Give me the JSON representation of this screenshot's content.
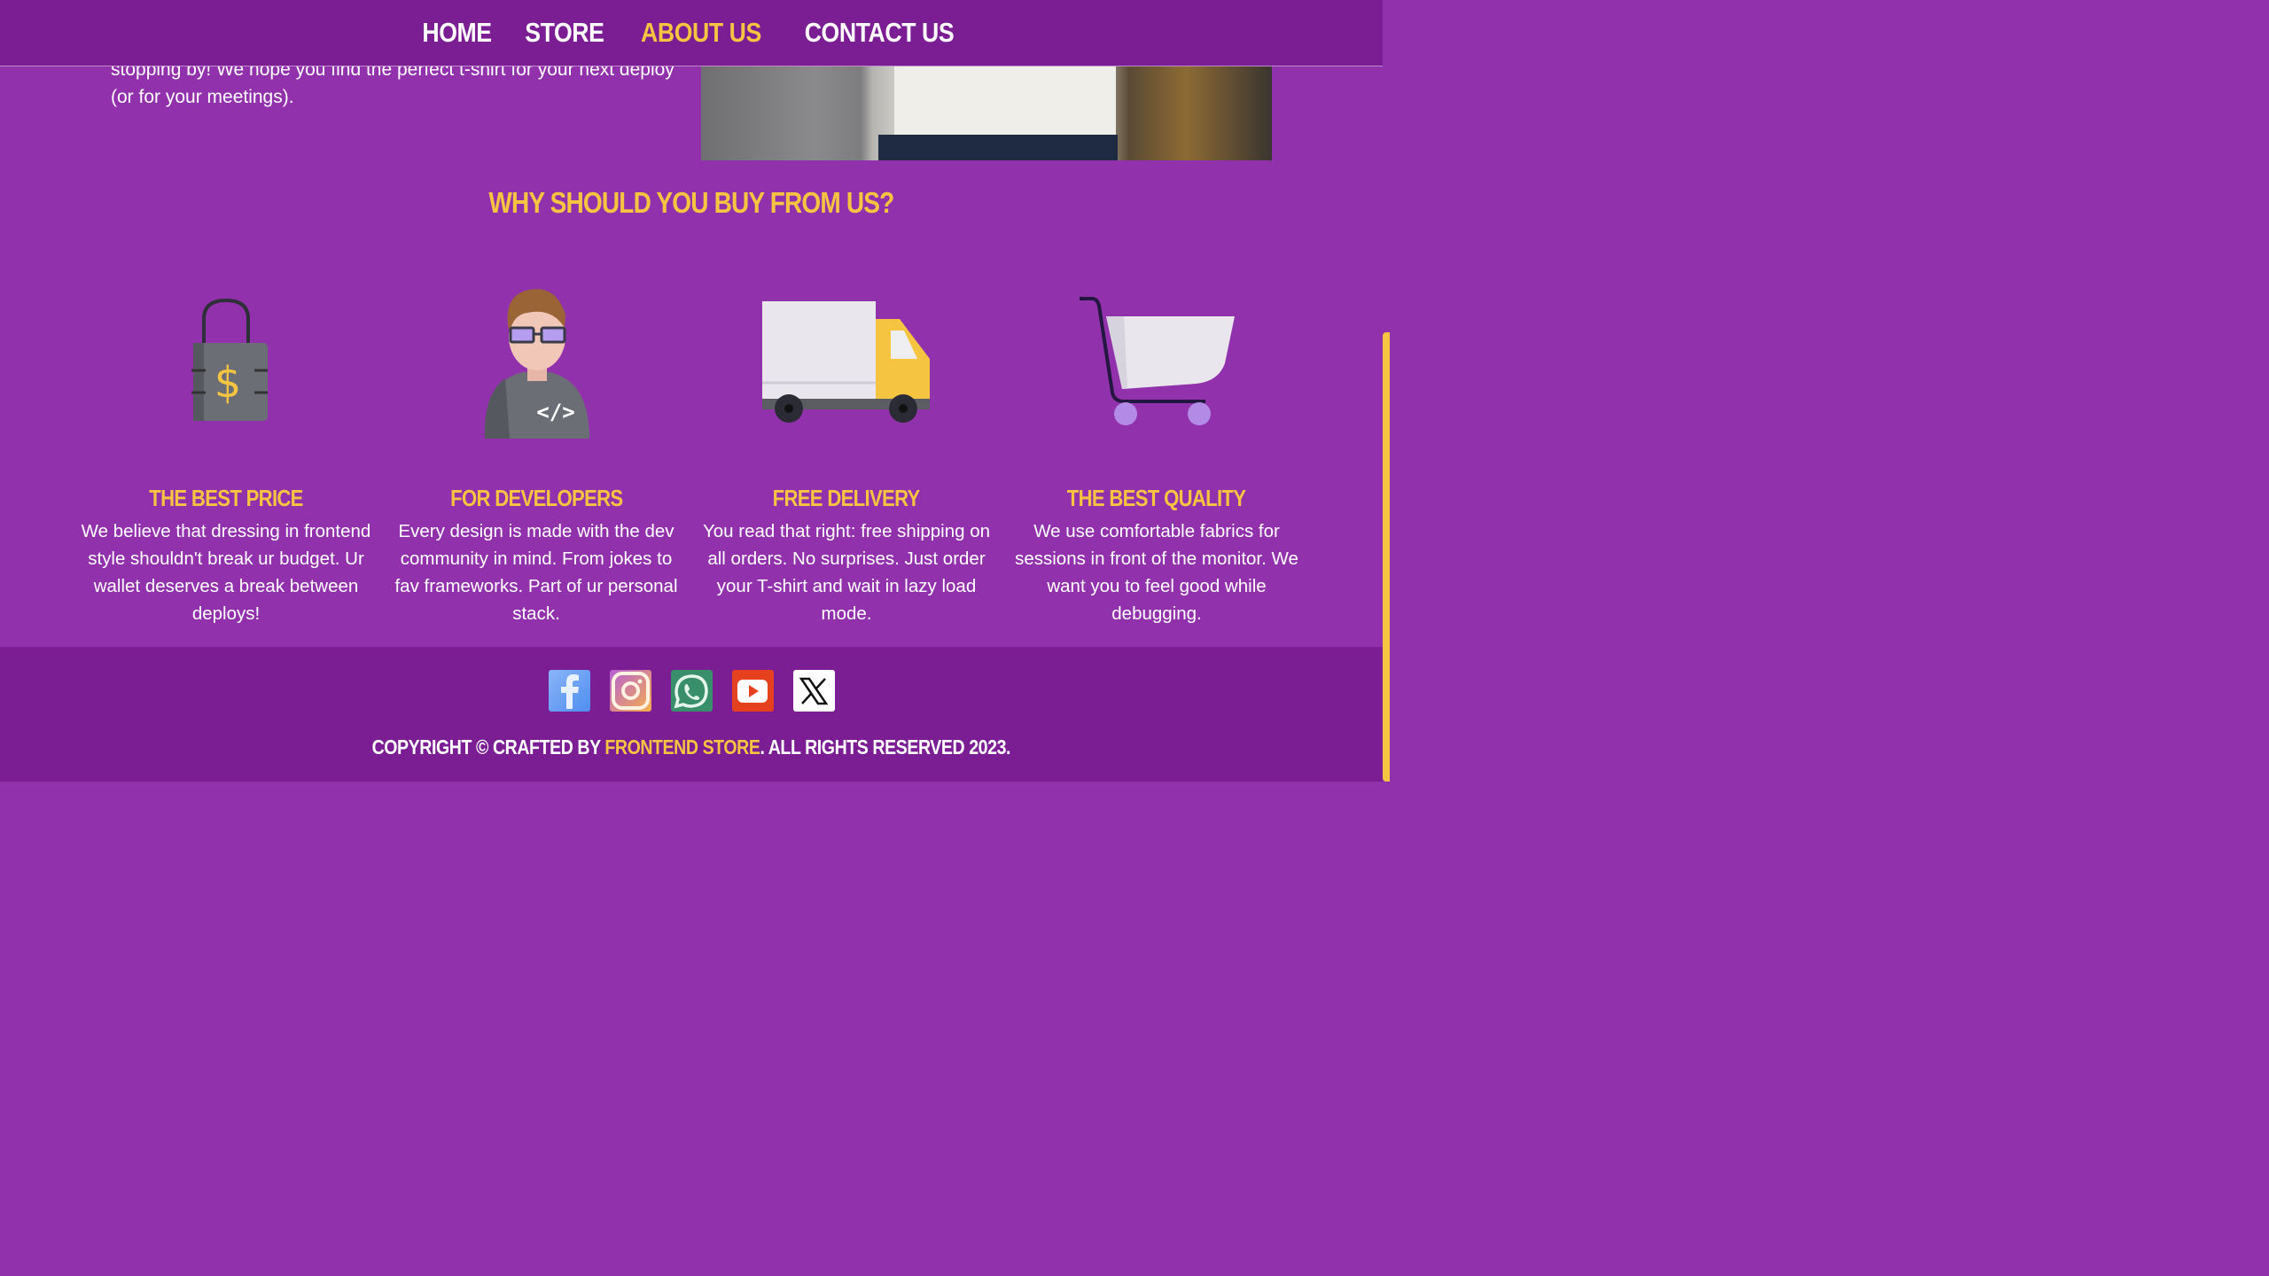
{
  "nav": {
    "items": [
      {
        "label": "HOME",
        "active": false
      },
      {
        "label": "STORE",
        "active": false
      },
      {
        "label": "ABOUT US",
        "active": true
      },
      {
        "label": "CONTACT US",
        "active": false
      }
    ]
  },
  "about": {
    "text_line1": "stopping by! We hope you find the perfect t-shirt for your next deploy",
    "text_line2": "(or for your meetings)."
  },
  "why": {
    "title": "WHY SHOULD YOU BUY FROM US?",
    "features": [
      {
        "icon": "price-tag-icon",
        "title": "THE BEST PRICE",
        "text": "We believe that dressing in frontend style shouldn't break ur budget. Ur wallet deserves a break between deploys!"
      },
      {
        "icon": "developer-icon",
        "title": "FOR DEVELOPERS",
        "text": "Every design is made with the dev community in mind. From jokes to fav frameworks. Part of ur personal stack."
      },
      {
        "icon": "delivery-truck-icon",
        "title": "FREE DELIVERY",
        "text": "You read that right: free shipping on all orders. No surprises. Just order your T-shirt and wait in lazy load mode."
      },
      {
        "icon": "shopping-cart-icon",
        "title": "THE BEST QUALITY",
        "text": "We use comfortable fabrics for sessions in front of the monitor. We want you to feel good while debugging."
      }
    ]
  },
  "footer": {
    "socials": [
      "facebook-icon",
      "instagram-icon",
      "whatsapp-icon",
      "youtube-icon",
      "x-icon"
    ],
    "copyright_prefix": "COPYRIGHT © CRAFTED BY ",
    "copyright_brand": "FRONTEND STORE",
    "copyright_suffix": ". ALL RIGHTS RESERVED 2023."
  },
  "colors": {
    "accent": "#f5c542",
    "background": "#9231ac",
    "header": "#7b1e94"
  }
}
